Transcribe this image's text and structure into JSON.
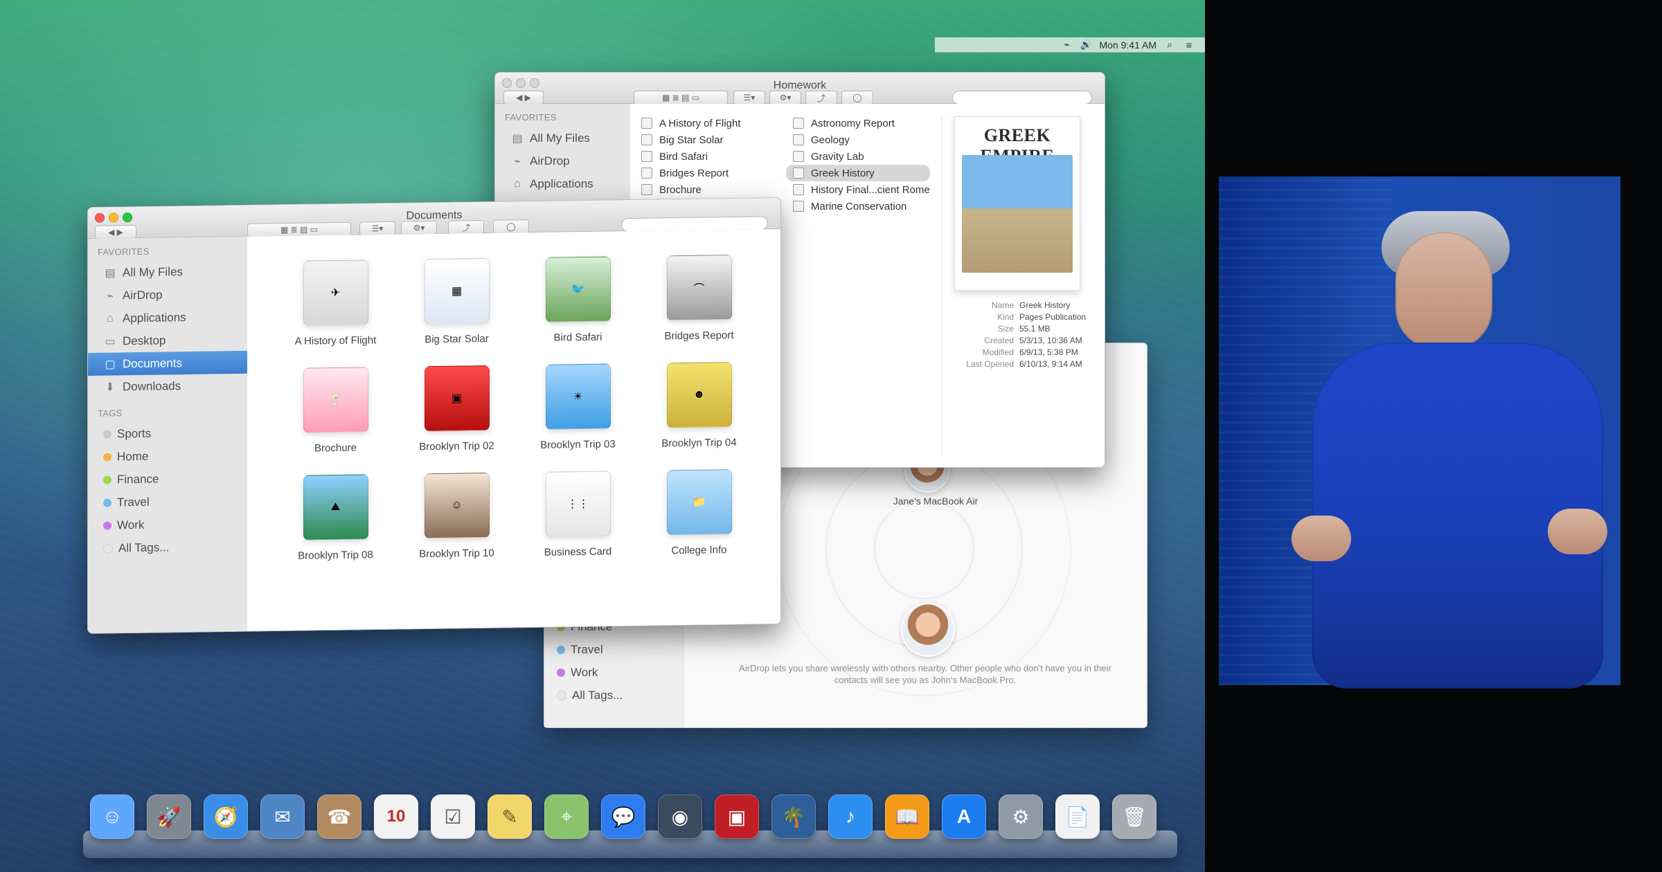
{
  "menubar": {
    "time_text": "Mon 9:41 AM",
    "icons": [
      "wifi-icon",
      "volume-icon",
      "search-icon",
      "list-icon"
    ]
  },
  "homework_window": {
    "title": "Homework",
    "sidebar": {
      "favorites_heading": "FAVORITES",
      "items": [
        {
          "label": "All My Files",
          "icon": "file-stack-icon"
        },
        {
          "label": "AirDrop",
          "icon": "airdrop-icon"
        },
        {
          "label": "Applications",
          "icon": "apps-icon"
        }
      ]
    },
    "files_col1": [
      "A History of Flight",
      "Big Star Solar",
      "Bird Safari",
      "Bridges Report",
      "Brochure"
    ],
    "files_col2": [
      "Astronomy Report",
      "Geology",
      "Gravity Lab",
      "Greek History",
      "History Final...cient Rome",
      "Marine Conservation"
    ],
    "preview": {
      "doc_title": "GREEK EMPIRE",
      "meta": [
        {
          "k": "Name",
          "v": "Greek History"
        },
        {
          "k": "Kind",
          "v": "Pages Publication"
        },
        {
          "k": "Size",
          "v": "55.1 MB"
        },
        {
          "k": "Created",
          "v": "5/3/13, 10:36 AM"
        },
        {
          "k": "Modified",
          "v": "6/9/13, 5:38 PM"
        },
        {
          "k": "Last Opened",
          "v": "6/10/13, 9:14 AM"
        }
      ]
    }
  },
  "documents_window": {
    "title": "Documents",
    "sidebar": {
      "favorites_heading": "FAVORITES",
      "favorites": [
        {
          "label": "All My Files",
          "icon": "file-stack-icon"
        },
        {
          "label": "AirDrop",
          "icon": "airdrop-icon"
        },
        {
          "label": "Applications",
          "icon": "apps-icon"
        },
        {
          "label": "Desktop",
          "icon": "desktop-icon"
        },
        {
          "label": "Documents",
          "icon": "documents-icon",
          "selected": true
        },
        {
          "label": "Downloads",
          "icon": "downloads-icon"
        }
      ],
      "tags_heading": "TAGS",
      "tags": [
        {
          "label": "Sports",
          "color": "#c9c9c9"
        },
        {
          "label": "Home",
          "color": "#f1b347"
        },
        {
          "label": "Finance",
          "color": "#a6d64a"
        },
        {
          "label": "Travel",
          "color": "#74b7ea"
        },
        {
          "label": "Work",
          "color": "#c57ae6"
        },
        {
          "label": "All Tags...",
          "color": "#e7e7e7"
        }
      ]
    },
    "grid_items": [
      {
        "label": "A History of Flight"
      },
      {
        "label": "Big Star Solar"
      },
      {
        "label": "Bird Safari"
      },
      {
        "label": "Bridges Report"
      },
      {
        "label": "Brochure"
      },
      {
        "label": "Brooklyn Trip 02"
      },
      {
        "label": "Brooklyn Trip 03"
      },
      {
        "label": "Brooklyn Trip 04"
      },
      {
        "label": "Brooklyn Trip 08"
      },
      {
        "label": "Brooklyn Trip 10"
      },
      {
        "label": "Business Card"
      },
      {
        "label": "College Info"
      }
    ]
  },
  "airdrop_window": {
    "tags_partial": [
      "Finance",
      "Travel",
      "Work",
      "All Tags..."
    ],
    "person_top_label": "Jane's MacBook Air",
    "message": "AirDrop lets you share wirelessly with others nearby. Other people who don't have you in their contacts will see you as John's MacBook Pro."
  },
  "dock": {
    "icons": [
      {
        "name": "finder-icon",
        "glyph": "☺",
        "color": "#5fa6ff"
      },
      {
        "name": "launchpad-icon",
        "glyph": "🚀",
        "color": "#7f8792"
      },
      {
        "name": "safari-icon",
        "glyph": "🧭",
        "color": "#3a8ee8"
      },
      {
        "name": "mail-icon",
        "glyph": "✉",
        "color": "#4f86c6"
      },
      {
        "name": "contacts-icon",
        "glyph": "☎",
        "color": "#b28a61"
      },
      {
        "name": "calendar-icon",
        "glyph": "10",
        "color": "#f2f2f2"
      },
      {
        "name": "reminders-icon",
        "glyph": "☑",
        "color": "#f2f2f2"
      },
      {
        "name": "notes-icon",
        "glyph": "✎",
        "color": "#f2d56b"
      },
      {
        "name": "maps-icon",
        "glyph": "⌖",
        "color": "#8ac36b"
      },
      {
        "name": "messages-icon",
        "glyph": "💬",
        "color": "#2f7cf0"
      },
      {
        "name": "facetime-icon",
        "glyph": "◉",
        "color": "#394b5c"
      },
      {
        "name": "photo-booth-icon",
        "glyph": "▣",
        "color": "#c01f26"
      },
      {
        "name": "iphoto-icon",
        "glyph": "🌴",
        "color": "#2e5f9b"
      },
      {
        "name": "itunes-icon",
        "glyph": "♪",
        "color": "#2d8ef1"
      },
      {
        "name": "ibooks-icon",
        "glyph": "📖",
        "color": "#f39b18"
      },
      {
        "name": "app-store-icon",
        "glyph": "A",
        "color": "#1d7ef2"
      },
      {
        "name": "system-preferences-icon",
        "glyph": "⚙",
        "color": "#8f9aa7"
      },
      {
        "name": "preview-document-icon",
        "glyph": "📄",
        "color": "#f1f1f1"
      },
      {
        "name": "trash-icon",
        "glyph": "🗑",
        "color": "#a6abb1"
      }
    ]
  }
}
